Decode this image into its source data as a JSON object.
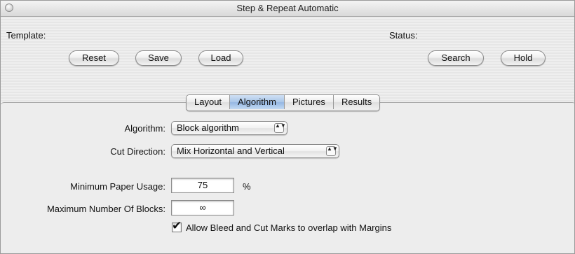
{
  "window": {
    "title": "Step & Repeat Automatic"
  },
  "template": {
    "label": "Template:",
    "buttons": {
      "reset": "Reset",
      "save": "Save",
      "load": "Load"
    }
  },
  "status": {
    "label": "Status:",
    "buttons": {
      "search": "Search",
      "hold": "Hold"
    }
  },
  "tabs": [
    {
      "label": "Layout",
      "selected": false
    },
    {
      "label": "Algorithm",
      "selected": true
    },
    {
      "label": "Pictures",
      "selected": false
    },
    {
      "label": "Results",
      "selected": false
    }
  ],
  "form": {
    "algorithm": {
      "label": "Algorithm:",
      "value": "Block algorithm",
      "arrows": "▲▼"
    },
    "cut_direction": {
      "label": "Cut Direction:",
      "value": "Mix Horizontal and Vertical",
      "arrows": "▲▼"
    },
    "min_paper_usage": {
      "label": "Minimum Paper Usage:",
      "value": "75",
      "unit": "%"
    },
    "max_blocks": {
      "label": "Maximum Number Of Blocks:",
      "value": "∞"
    },
    "allow_bleed": {
      "label": "Allow Bleed and Cut Marks to overlap with Margins",
      "checked": true,
      "mark": "✔"
    }
  }
}
